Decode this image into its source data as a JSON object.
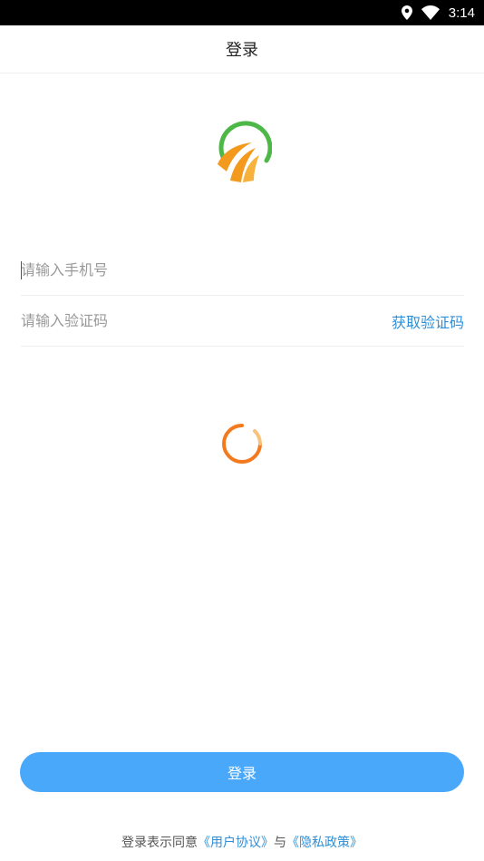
{
  "status_bar": {
    "time": "3:14",
    "icons": [
      "location-icon",
      "wifi-icon"
    ]
  },
  "header": {
    "title": "登录"
  },
  "logo": {
    "icon": "app-logo",
    "colors": {
      "green": "#4db848",
      "orange": "#f39a1e"
    }
  },
  "form": {
    "phone": {
      "placeholder": "请输入手机号",
      "value": ""
    },
    "code": {
      "placeholder": "请输入验证码",
      "value": ""
    },
    "get_code_label": "获取验证码"
  },
  "loading": {
    "icon": "loading-spinner-icon"
  },
  "login_button": {
    "label": "登录",
    "color": "#4aa8fb"
  },
  "agreement": {
    "prefix": "登录表示同意",
    "user_agreement": "《用户协议》",
    "conjunction": "与",
    "privacy_policy": "《隐私政策》",
    "link_color": "#2f8fd6"
  }
}
